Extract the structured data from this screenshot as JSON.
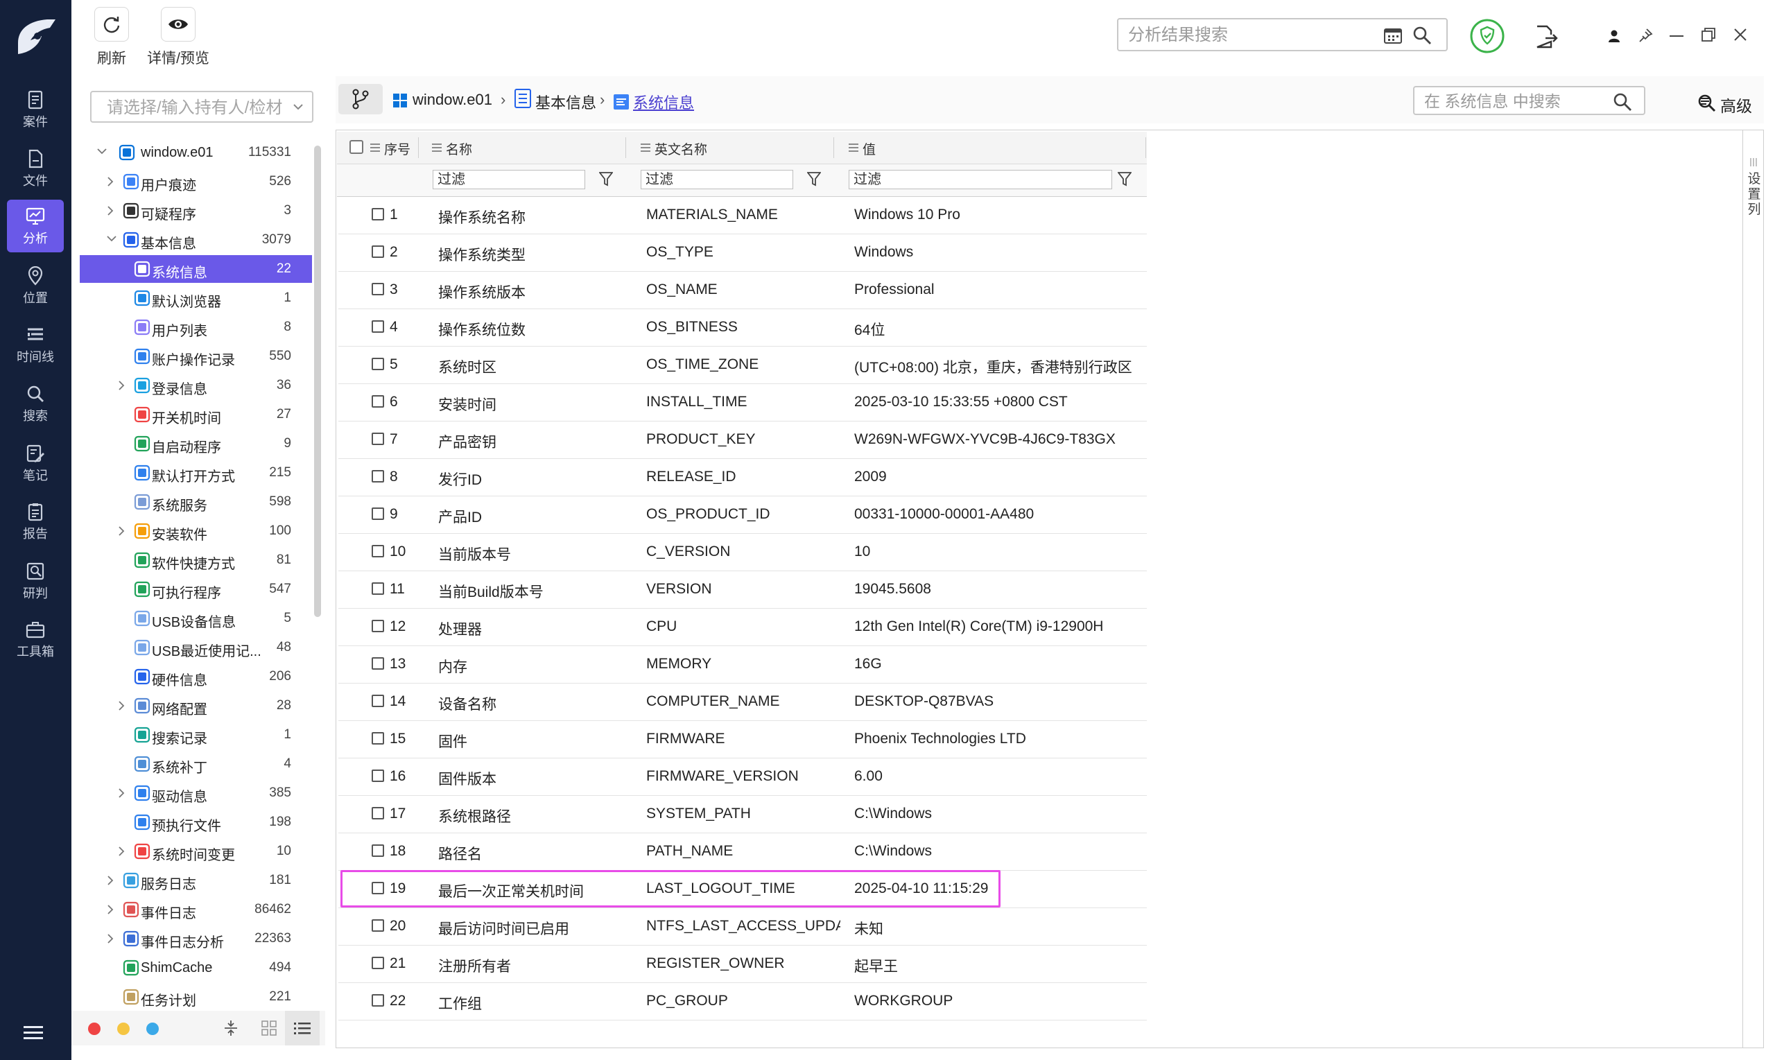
{
  "nav": {
    "items": [
      {
        "label": "案件",
        "icon": "case-icon"
      },
      {
        "label": "文件",
        "icon": "file-icon"
      },
      {
        "label": "分析",
        "icon": "analysis-icon",
        "active": true
      },
      {
        "label": "位置",
        "icon": "location-icon"
      },
      {
        "label": "时间线",
        "icon": "timeline-icon"
      },
      {
        "label": "搜索",
        "icon": "search-icon"
      },
      {
        "label": "笔记",
        "icon": "note-icon"
      },
      {
        "label": "报告",
        "icon": "report-icon"
      },
      {
        "label": "研判",
        "icon": "judge-icon"
      },
      {
        "label": "工具箱",
        "icon": "toolbox-icon"
      }
    ]
  },
  "toolbar": {
    "refresh_label": "刷新",
    "preview_label": "详情/预览",
    "search_placeholder": "分析结果搜索"
  },
  "sidebar": {
    "filter_placeholder": "请选择/输入持有人/检材",
    "tree": [
      {
        "label": "window.e01",
        "count": "115331",
        "icon": "windows-icon",
        "color": "#0a73d9"
      },
      {
        "label": "用户痕迹",
        "count": "526",
        "icon": "footprint-icon",
        "color": "#3b82f6"
      },
      {
        "label": "可疑程序",
        "count": "3",
        "icon": "suspicious-icon",
        "color": "#333333"
      },
      {
        "label": "基本信息",
        "count": "3079",
        "icon": "basic-info-icon",
        "color": "#2563eb"
      },
      {
        "label": "系统信息",
        "count": "22",
        "icon": "system-info-icon",
        "color": "#3b82f6"
      },
      {
        "label": "默认浏览器",
        "count": "1",
        "icon": "browser-icon",
        "color": "#1e88e5"
      },
      {
        "label": "用户列表",
        "count": "8",
        "icon": "user-list-icon",
        "color": "#8b7cf6"
      },
      {
        "label": "账户操作记录",
        "count": "550",
        "icon": "account-log-icon",
        "color": "#2f80ed"
      },
      {
        "label": "登录信息",
        "count": "36",
        "icon": "login-icon",
        "color": "#1aa0e0"
      },
      {
        "label": "开关机时间",
        "count": "27",
        "icon": "power-icon",
        "color": "#ef4444"
      },
      {
        "label": "自启动程序",
        "count": "9",
        "icon": "autostart-icon",
        "color": "#22a35a"
      },
      {
        "label": "默认打开方式",
        "count": "215",
        "icon": "default-open-icon",
        "color": "#2f80ed"
      },
      {
        "label": "系统服务",
        "count": "598",
        "icon": "service-icon",
        "color": "#7b9cd6"
      },
      {
        "label": "安装软件",
        "count": "100",
        "icon": "software-icon",
        "color": "#f59e0b"
      },
      {
        "label": "软件快捷方式",
        "count": "81",
        "icon": "shortcut-icon",
        "color": "#22a35a"
      },
      {
        "label": "可执行程序",
        "count": "547",
        "icon": "executable-icon",
        "color": "#22a35a"
      },
      {
        "label": "USB设备信息",
        "count": "5",
        "icon": "usb-icon",
        "color": "#7aa7e8"
      },
      {
        "label": "USB最近使用记...",
        "count": "48",
        "icon": "usb-recent-icon",
        "color": "#7aa7e8"
      },
      {
        "label": "硬件信息",
        "count": "206",
        "icon": "hardware-icon",
        "color": "#2563eb"
      },
      {
        "label": "网络配置",
        "count": "28",
        "icon": "network-icon",
        "color": "#5b8bd6"
      },
      {
        "label": "搜索记录",
        "count": "1",
        "icon": "search-record-icon",
        "color": "#16a394"
      },
      {
        "label": "系统补丁",
        "count": "4",
        "icon": "patch-icon",
        "color": "#4f8fd6"
      },
      {
        "label": "驱动信息",
        "count": "385",
        "icon": "driver-icon",
        "color": "#2f80ed"
      },
      {
        "label": "预执行文件",
        "count": "198",
        "icon": "prefetch-icon",
        "color": "#2f80ed"
      },
      {
        "label": "系统时间变更",
        "count": "10",
        "icon": "time-change-icon",
        "color": "#ef4444"
      },
      {
        "label": "服务日志",
        "count": "181",
        "icon": "service-log-icon",
        "color": "#38a0e0"
      },
      {
        "label": "事件日志",
        "count": "86462",
        "icon": "event-log-icon",
        "color": "#e05555"
      },
      {
        "label": "事件日志分析",
        "count": "22363",
        "icon": "event-analysis-icon",
        "color": "#3d6fd6"
      },
      {
        "label": "ShimCache",
        "count": "494",
        "icon": "shimcache-icon",
        "color": "#22a35a"
      },
      {
        "label": "任务计划",
        "count": "221",
        "icon": "task-icon",
        "color": "#c0a060"
      }
    ]
  },
  "breadcrumb": {
    "items": [
      "window.e01",
      "基本信息",
      "系统信息"
    ],
    "search_placeholder": "在 系统信息 中搜索",
    "advanced_label": "高级"
  },
  "table": {
    "headers": [
      "序号",
      "名称",
      "英文名称",
      "值"
    ],
    "filter_text": "过滤",
    "settings_label": "设置列",
    "rows": [
      [
        "1",
        "操作系统名称",
        "MATERIALS_NAME",
        "Windows 10 Pro"
      ],
      [
        "2",
        "操作系统类型",
        "OS_TYPE",
        "Windows"
      ],
      [
        "3",
        "操作系统版本",
        "OS_NAME",
        "Professional"
      ],
      [
        "4",
        "操作系统位数",
        "OS_BITNESS",
        "64位"
      ],
      [
        "5",
        "系统时区",
        "OS_TIME_ZONE",
        "(UTC+08:00) 北京，重庆，香港特别行政区..."
      ],
      [
        "6",
        "安装时间",
        "INSTALL_TIME",
        "2025-03-10 15:33:55 +0800 CST"
      ],
      [
        "7",
        "产品密钥",
        "PRODUCT_KEY",
        "W269N-WFGWX-YVC9B-4J6C9-T83GX"
      ],
      [
        "8",
        "发行ID",
        "RELEASE_ID",
        "2009"
      ],
      [
        "9",
        "产品ID",
        "OS_PRODUCT_ID",
        "00331-10000-00001-AA480"
      ],
      [
        "10",
        "当前版本号",
        "C_VERSION",
        "10"
      ],
      [
        "11",
        "当前Build版本号",
        "VERSION",
        "19045.5608"
      ],
      [
        "12",
        "处理器",
        "CPU",
        "12th Gen Intel(R) Core(TM) i9-12900H"
      ],
      [
        "13",
        "内存",
        "MEMORY",
        "16G"
      ],
      [
        "14",
        "设备名称",
        "COMPUTER_NAME",
        "DESKTOP-Q87BVAS"
      ],
      [
        "15",
        "固件",
        "FIRMWARE",
        "Phoenix Technologies LTD"
      ],
      [
        "16",
        "固件版本",
        "FIRMWARE_VERSION",
        "6.00"
      ],
      [
        "17",
        "系统根路径",
        "SYSTEM_PATH",
        "C:\\Windows"
      ],
      [
        "18",
        "路径名",
        "PATH_NAME",
        "C:\\Windows"
      ],
      [
        "19",
        "最后一次正常关机时间",
        "LAST_LOGOUT_TIME",
        "2025-04-10 11:15:29"
      ],
      [
        "20",
        "最后访问时间已启用",
        "NTFS_LAST_ACCESS_UPDA...",
        "未知"
      ],
      [
        "21",
        "注册所有者",
        "REGISTER_OWNER",
        "起早王"
      ],
      [
        "22",
        "工作组",
        "PC_GROUP",
        "WORKGROUP"
      ]
    ],
    "highlighted_row": "19"
  },
  "colors": {
    "nav_bg": "#14203a",
    "accent": "#6a59e8",
    "highlight_border": "#e84ce8",
    "status_ok": "#3bb34a"
  }
}
